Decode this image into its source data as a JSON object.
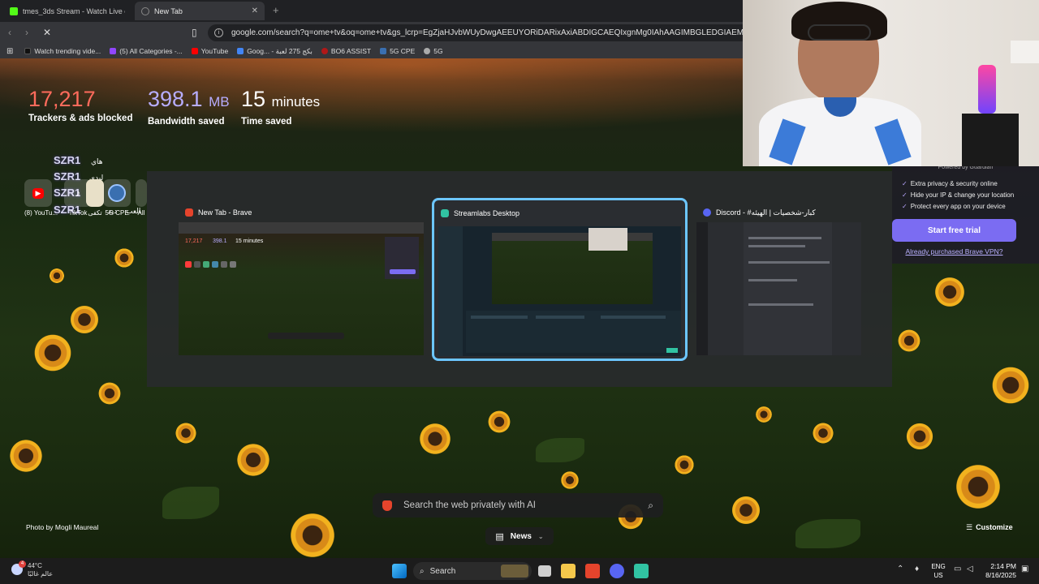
{
  "browser": {
    "tabs": [
      {
        "label": "tmes_3ds Stream - Watch Live on Ki",
        "color": "#53fc18"
      },
      {
        "label": "New Tab",
        "color": "#888888"
      }
    ],
    "url": "google.com/search?q=ome+tv&oq=ome+tv&gs_lcrp=EgZjaHJvbWUyDwgAEEUYORiDARixAxiABDIGCAEQIxgnMg0IAhAAGIMBGLEDGIAEMhMIAxAuGIM...",
    "bookmarks": [
      {
        "label": "Watch trending vide...",
        "color": "#111111"
      },
      {
        "label": "(5) All Categories -...",
        "color": "#9146ff"
      },
      {
        "label": "YouTube",
        "color": "#ff0000"
      },
      {
        "label": "Goog... - بكج 275 لعبة",
        "color": "#4285f4"
      },
      {
        "label": "BO6 ASSIST",
        "color": "#b01818"
      },
      {
        "label": "5G CPE",
        "color": "#3a6fb0"
      },
      {
        "label": "5G",
        "color": "#aaaaaa"
      }
    ]
  },
  "stats": {
    "trackers": {
      "value": "17,217",
      "label": "Trackers & ads blocked",
      "color": "#ff6b5c"
    },
    "bandwidth": {
      "value": "398.1",
      "unit": "MB",
      "label": "Bandwidth saved",
      "color": "#b7adff"
    },
    "time": {
      "value": "15",
      "unit": "minutes",
      "label": "Time saved"
    }
  },
  "shortcuts": [
    {
      "label": "(8) YouTu...",
      "icon": "youtube-icon"
    },
    {
      "label": "TikTok",
      "icon": "tiktok-icon"
    },
    {
      "label": "تكفى",
      "icon": "takfa-icon"
    },
    {
      "label": "5G CPE",
      "icon": "5g-cpe-icon"
    },
    {
      "label": "All",
      "icon": "all-icon"
    }
  ],
  "overlay_text": {
    "szr": "SZR1",
    "arabic_1": "هاي",
    "arabic_2": "ليدي",
    "arabic_3": "العب",
    "arabic_4": "ديد"
  },
  "switcher": {
    "windows": [
      {
        "title": "New Tab - Brave",
        "icon_color": "#e5442c",
        "selected": false
      },
      {
        "title": "Streamlabs Desktop",
        "icon_color": "#31c3a2",
        "selected": true
      },
      {
        "title": "Discord - #كبار-شخصيات | الهيئه",
        "icon_color": "#5865f2",
        "selected": false
      }
    ],
    "thumb_stats": {
      "trackers": "17,217",
      "bandwidth": "398.1",
      "time": "15 minutes"
    }
  },
  "vpn": {
    "powered_by": "Powered by Guardian",
    "features": [
      "Extra privacy & security online",
      "Hide your IP & change your location",
      "Protect every app on your device"
    ],
    "cta": "Start free trial",
    "link": "Already purchased Brave VPN?"
  },
  "search": {
    "placeholder": "Search the web privately with AI"
  },
  "news": {
    "label": "News"
  },
  "photo_credit": "Photo by Mogli Maureal",
  "customize": "Customize",
  "taskbar": {
    "weather_temp": "44°C",
    "weather_desc": "عالم غالبًا",
    "search_label": "Search",
    "lang_1": "ENG",
    "lang_2": "US",
    "time": "2:14 PM",
    "date": "8/16/2025",
    "badge": "4"
  }
}
